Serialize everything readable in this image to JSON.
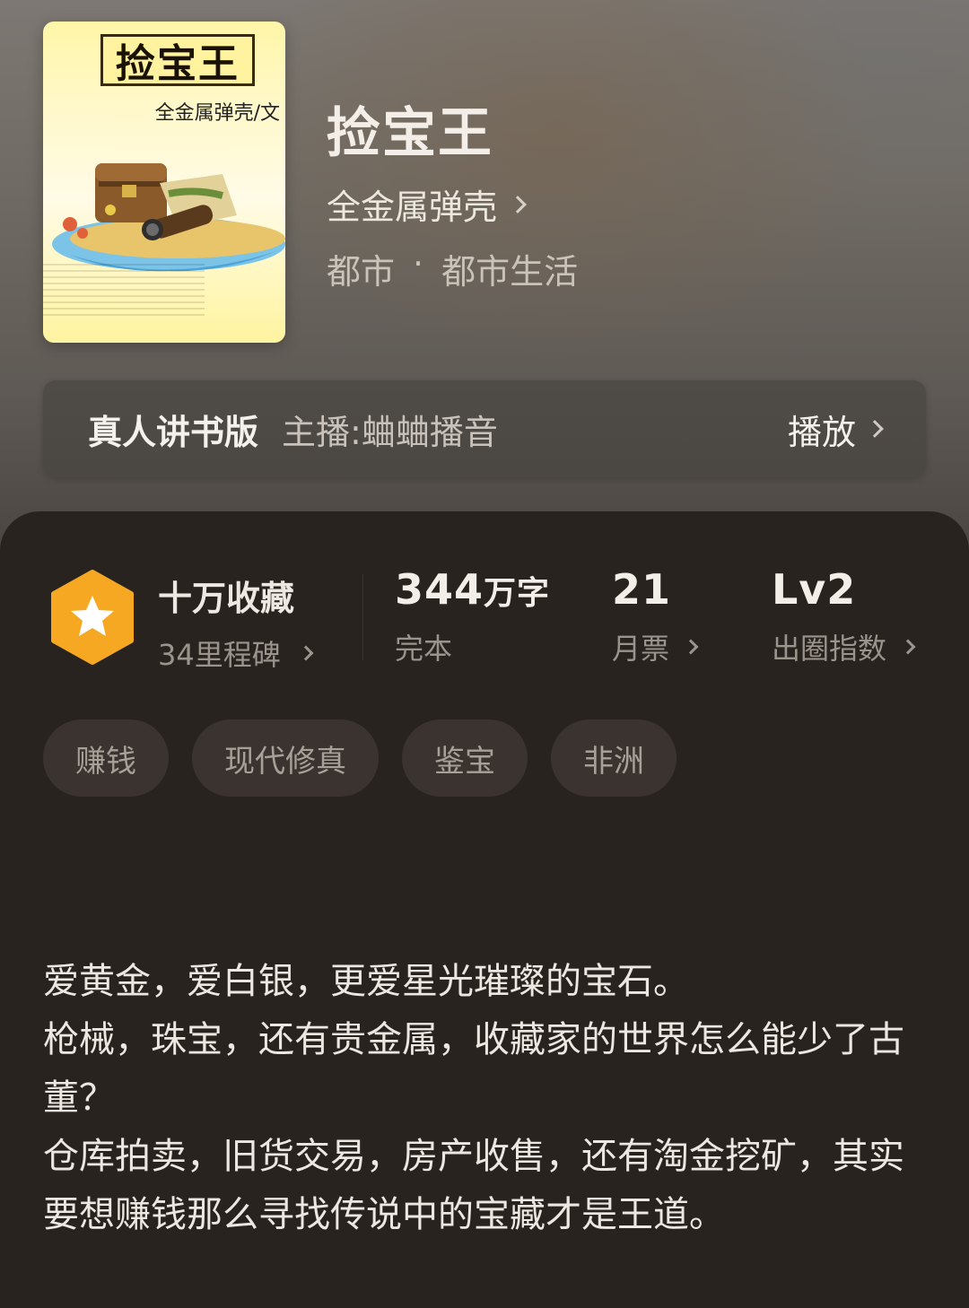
{
  "book": {
    "cover": {
      "title": "捡宝王",
      "author_line": "全金属弹壳/文"
    },
    "title": "捡宝王",
    "author": "全金属弹壳",
    "genres": [
      "都市",
      "都市生活"
    ],
    "genre_separator": "·"
  },
  "audio": {
    "label": "真人讲书版",
    "host": "主播:蛐蛐播音",
    "play_label": "播放"
  },
  "stats": {
    "badge": {
      "title": "十万收藏",
      "subtitle": "34里程碑",
      "color": "#f7a823"
    },
    "word_count": {
      "value": "344",
      "unit": "万字",
      "status": "完本"
    },
    "monthly_ticket": {
      "value": "21",
      "label": "月票"
    },
    "circle_index": {
      "value": "Lv2",
      "label": "出圈指数"
    }
  },
  "tags": [
    "赚钱",
    "现代修真",
    "鉴宝",
    "非洲"
  ],
  "synopsis": [
    "爱黄金，爱白银，更爱星光璀璨的宝石。",
    "枪械，珠宝，还有贵金属，收藏家的世界怎么能少了古董？",
    "仓库拍卖，旧货交易，房产收售，还有淘金挖矿，其实要想赚钱那么寻找传说中的宝藏才是王道。"
  ]
}
